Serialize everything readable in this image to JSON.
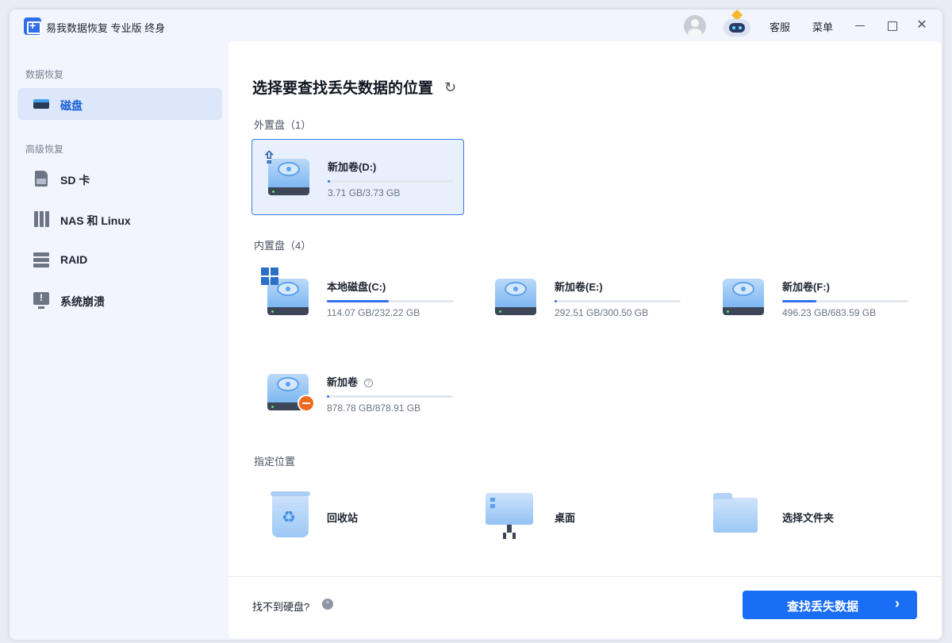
{
  "titlebar": {
    "app_title": "易我数据恢复 专业版 终身",
    "support_label": "客服",
    "menu_label": "菜单",
    "minimize_glyph": "",
    "maximize_glyph": "",
    "close_glyph": "✕"
  },
  "sidebar": {
    "section_data_recovery": "数据恢复",
    "section_advanced": "高级恢复",
    "items": [
      {
        "label": "磁盘",
        "icon": "disk-icon",
        "active": true
      },
      {
        "label": "SD 卡",
        "icon": "sd-card-icon"
      },
      {
        "label": "NAS 和 Linux",
        "icon": "nas-icon"
      },
      {
        "label": "RAID",
        "icon": "raid-icon"
      },
      {
        "label": "系统崩溃",
        "icon": "system-crash-icon"
      }
    ]
  },
  "main": {
    "title": "选择要查找丢失数据的位置",
    "refresh_glyph": "↻",
    "external_label": "外置盘（1）",
    "internal_label": "内置盘（4）",
    "location_label": "指定位置",
    "external_drives": [
      {
        "name": "新加卷(D:)",
        "size": "3.71 GB/3.73 GB",
        "used_fraction": 0.02,
        "badge": "usb-icon",
        "selected": true
      }
    ],
    "internal_drives": [
      {
        "name": "本地磁盘(C:)",
        "size": "114.07 GB/232.22 GB",
        "used_fraction": 0.49,
        "badge": "windows-icon"
      },
      {
        "name": "新加卷(E:)",
        "size": "292.51 GB/300.50 GB",
        "used_fraction": 0.02
      },
      {
        "name": "新加卷(F:)",
        "size": "496.23 GB/683.59 GB",
        "used_fraction": 0.27
      },
      {
        "name": "新加卷",
        "size": "878.78 GB/878.91 GB",
        "used_fraction": 0.02,
        "badge": "error-minus-icon",
        "help_glyph": "?"
      }
    ],
    "locations": [
      {
        "name": "回收站",
        "icon": "recycle-bin-icon",
        "glyph": "♻"
      },
      {
        "name": "桌面",
        "icon": "desktop-icon"
      },
      {
        "name": "选择文件夹",
        "icon": "folder-icon"
      }
    ]
  },
  "footer": {
    "no_disk_text": "找不到硬盘?",
    "toggle_glyph": "⌃",
    "scan_button_label": "查找丢失数据",
    "scan_arrow": "›"
  },
  "colors": {
    "accent": "#1a6ef5",
    "selected_bg": "#e8f0fd",
    "sidebar_active_bg": "#dce7fb",
    "error_badge": "#f06a1d"
  }
}
